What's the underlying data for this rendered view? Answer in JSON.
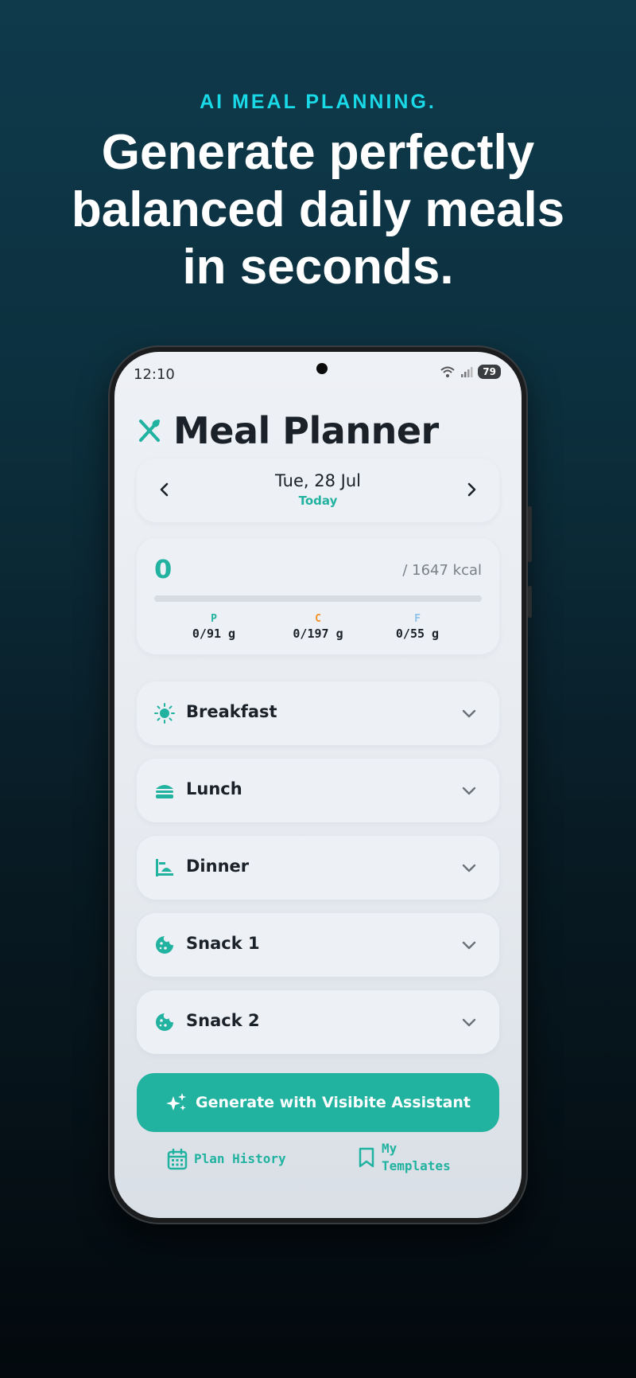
{
  "promo": {
    "tagline": "AI MEAL PLANNING.",
    "headline_lines": [
      "Generate perfectly",
      "balanced daily meals",
      "in seconds."
    ]
  },
  "status_bar": {
    "time": "12:10",
    "battery": "79"
  },
  "app": {
    "title": "Meal Planner",
    "title_icon": "fork-knife-icon"
  },
  "date_nav": {
    "date": "Tue, 28 Jul",
    "relative": "Today"
  },
  "calories": {
    "current": "0",
    "goal_text": "/ 1647 kcal",
    "progress_fraction": 0
  },
  "macros": [
    {
      "letter": "P",
      "value": "0/91 g",
      "color": "#21b2a0"
    },
    {
      "letter": "C",
      "value": "0/197 g",
      "color": "#f0922a"
    },
    {
      "letter": "F",
      "value": "0/55 g",
      "color": "#8fc4e8"
    }
  ],
  "meals": [
    {
      "label": "Breakfast",
      "icon": "sun-icon"
    },
    {
      "label": "Lunch",
      "icon": "burger-icon"
    },
    {
      "label": "Dinner",
      "icon": "dinner-table-icon"
    },
    {
      "label": "Snack 1",
      "icon": "cookie-icon"
    },
    {
      "label": "Snack 2",
      "icon": "cookie-icon"
    }
  ],
  "actions": {
    "generate_label": "Generate with Visibite Assistant",
    "plan_history_label": "Plan History",
    "templates_label_line1": "My",
    "templates_label_line2": "Templates"
  },
  "colors": {
    "accent": "#21b2a0",
    "tagline": "#1ad9e6"
  }
}
